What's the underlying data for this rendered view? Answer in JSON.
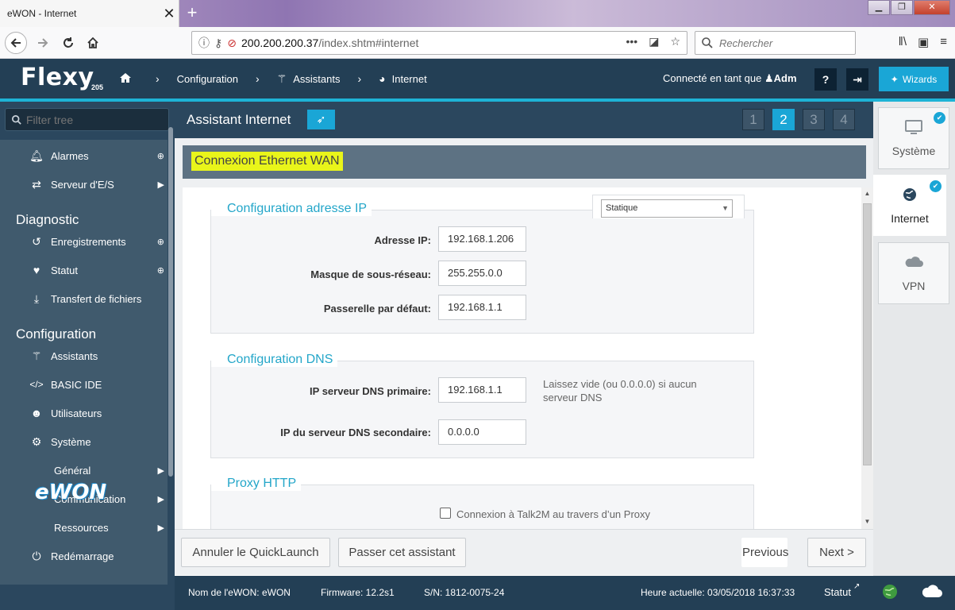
{
  "browser": {
    "tab_title": "eWON - Internet",
    "tab_close": "✕",
    "new_tab": "+",
    "url_host": "200.200.200.37",
    "url_path": "/index.shtm#internet",
    "search_placeholder": "Rechercher",
    "window_controls": {
      "minimize": "▁",
      "restore": "❐",
      "close": "✕"
    }
  },
  "header": {
    "logo": "Flexy",
    "model": "205",
    "breadcrumb": {
      "configuration": "Configuration",
      "assistants": "Assistants",
      "internet": "Internet"
    },
    "user_prefix": "Connecté en tant que",
    "user_name": "Adm",
    "wizards_label": "Wizards"
  },
  "sidebar": {
    "filter_placeholder": "Filter tree",
    "items": {
      "alarmes": "Alarmes",
      "serveur_es": "Serveur d'E/S",
      "diagnostic": "Diagnostic",
      "enregistrements": "Enregistrements",
      "statut": "Statut",
      "transfert": "Transfert de fichiers",
      "configuration": "Configuration",
      "assistants": "Assistants",
      "basic_ide": "BASIC IDE",
      "utilisateurs": "Utilisateurs",
      "systeme": "Système",
      "general": "Général",
      "communication": "Communication",
      "ressources": "Ressources",
      "redemarrage": "Redémarrage"
    },
    "footer_logo": "eWON"
  },
  "main": {
    "title": "Assistant Internet",
    "steps": [
      "1",
      "2",
      "3",
      "4"
    ],
    "active_step": "2",
    "section_title": "Connexion Ethernet WAN",
    "ip_config": {
      "legend": "Configuration adresse IP",
      "mode": "Statique",
      "ip_label": "Adresse IP:",
      "ip_value": "192.168.1.206",
      "mask_label": "Masque de sous-réseau:",
      "mask_value": "255.255.0.0",
      "gateway_label": "Passerelle par défaut:",
      "gateway_value": "192.168.1.1"
    },
    "dns_config": {
      "legend": "Configuration DNS",
      "primary_label": "IP serveur DNS primaire:",
      "primary_value": "192.168.1.1",
      "primary_help_line1": "Laissez vide (ou 0.0.0.0) si aucun",
      "primary_help_line2": "serveur DNS",
      "secondary_label": "IP du serveur DNS secondaire:",
      "secondary_value": "0.0.0.0"
    },
    "proxy": {
      "legend": "Proxy HTTP",
      "checkbox_label": "Connexion à Talk2M au travers d’un Proxy",
      "checked": false
    },
    "buttons": {
      "cancel": "Annuler le QuickLaunch",
      "skip": "Passer cet assistant",
      "previous": "Previous",
      "next": "Next >"
    }
  },
  "right_panel": {
    "systeme": "Système",
    "internet": "Internet",
    "vpn": "VPN"
  },
  "statusbar": {
    "name": "Nom de l'eWON: eWON",
    "firmware": "Firmware: 12.2s1",
    "serial": "S/N: 1812-0075-24",
    "time": "Heure actuelle: 03/05/2018 16:37:33",
    "statut": "Statut"
  },
  "colors": {
    "header": "#233f55",
    "accent": "#1aa6d6",
    "sidebar": "#405a6d",
    "highlight": "#e9f51a"
  }
}
